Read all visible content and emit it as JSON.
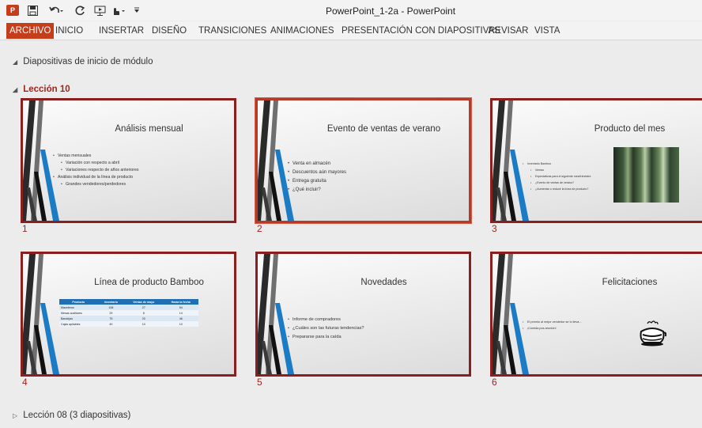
{
  "window": {
    "title": "PowerPoint_1-2a - PowerPoint",
    "app_icon_label": "P"
  },
  "quick_access": {
    "save": "💾",
    "undo": "↶ ▾",
    "redo": "↻",
    "present": "▣",
    "touch": "☝▾",
    "customize": "▾"
  },
  "ribbon": {
    "tabs": [
      "ARCHIVO",
      "INICIO",
      "INSERTAR",
      "DISEÑO",
      "TRANSICIONES",
      "ANIMACIONES",
      "PRESENTACIÓN CON DIAPOSITIVAS",
      "REVISAR",
      "VISTA"
    ],
    "active_tab": "ARCHIVO"
  },
  "sections": {
    "intro": {
      "triangle": "◢",
      "label": "Diapositivas de inicio de módulo"
    },
    "lesson10": {
      "triangle": "◢",
      "label": "Lección 10"
    },
    "lesson08": {
      "triangle": "▷",
      "label": "Lección 08 (3 diapositivas)"
    }
  },
  "slides": [
    {
      "number": "1",
      "title": "Análisis mensual",
      "bullets": [
        {
          "level": 1,
          "text": "Ventas mensuales"
        },
        {
          "level": 2,
          "text": "Variación con respecto a abril"
        },
        {
          "level": 2,
          "text": "Variaciones respecto de años anteriores"
        },
        {
          "level": 1,
          "text": "Análisis individual de la línea de producto"
        },
        {
          "level": 2,
          "text": "Grandes vendedores/perdedores"
        }
      ]
    },
    {
      "number": "2",
      "title": "Evento de ventas de verano",
      "selected": true,
      "bullets": [
        {
          "level": 1,
          "text": "Venta en almacén"
        },
        {
          "level": 1,
          "text": "Descuentos aún mayores"
        },
        {
          "level": 1,
          "text": "Entrega gratuita"
        },
        {
          "level": 1,
          "text": "¿Qué incluir?"
        }
      ]
    },
    {
      "number": "3",
      "title": "Producto del mes",
      "bullets": [
        {
          "level": 1,
          "text": "Inventario Bamboo"
        },
        {
          "level": 2,
          "text": "Ventas"
        },
        {
          "level": 2,
          "text": "Expectativas para el siguiente mes/trimestre"
        },
        {
          "level": 2,
          "text": "¿Evento de ventas de verano?"
        },
        {
          "level": 2,
          "text": "¿Aumentar o reducir la línea de producto?"
        }
      ]
    },
    {
      "number": "4",
      "title": "Línea de producto Bamboo",
      "table": {
        "headers": [
          "Producto",
          "Inventario",
          "Ventas de mayo",
          "Hasta la fecha"
        ],
        "rows": [
          [
            "Maceteros",
            "108",
            "27",
            "54"
          ],
          [
            "Mesas auxiliares",
            "29",
            "8",
            "14"
          ],
          [
            "Bandejas",
            "75",
            "20",
            "46"
          ],
          [
            "Cajas apilables",
            "40",
            "10",
            "10"
          ]
        ]
      }
    },
    {
      "number": "5",
      "title": "Novedades",
      "bullets": [
        {
          "level": 1,
          "text": "Informe de compradores"
        },
        {
          "level": 1,
          "text": "¿Cuáles son las futuras tendencias?"
        },
        {
          "level": 1,
          "text": "Prepararse para la caída"
        }
      ]
    },
    {
      "number": "6",
      "title": "Felicitaciones",
      "bullets": [
        {
          "level": 1,
          "text": "El premio al mejor vendedor se lo lleva..."
        },
        {
          "level": 1,
          "text": "¡Comida pos-reunión!"
        }
      ]
    }
  ],
  "colors": {
    "accent": "#c43e1c",
    "section_header": "#a1261c",
    "slide_border": "#8b1f1f",
    "table_header": "#1f6fb2"
  },
  "icons": {
    "stripes": "diagonal-blue-black-stripes",
    "bamboo": "bamboo-photo",
    "teapot": "teapot-clipart"
  }
}
